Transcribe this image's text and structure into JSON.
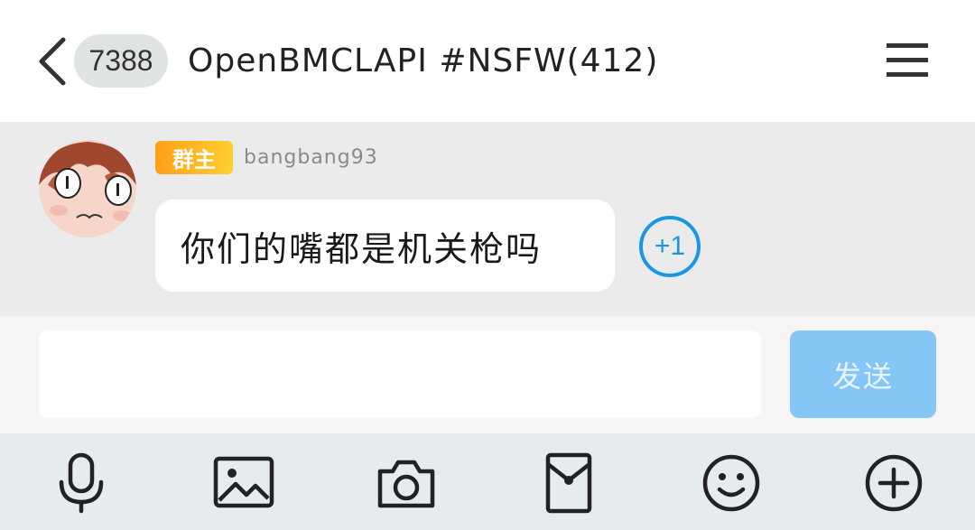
{
  "header": {
    "unread_count": "7388",
    "title": "OpenBMCLAPI #NSFW(412)"
  },
  "message": {
    "role_badge": "群主",
    "sender": "bangbang93",
    "text": "你们的嘴都是机关枪吗",
    "plus_one_label": "+1"
  },
  "composer": {
    "input_value": "",
    "send_label": "发送",
    "send_color": "#86c6f6"
  },
  "toolbar": {
    "tools": [
      "microphone-icon",
      "image-icon",
      "camera-icon",
      "red-packet-icon",
      "emoji-icon",
      "plus-icon"
    ]
  },
  "colors": {
    "accent": "#1a96e6",
    "badge_gradient_start": "#ff9f1a",
    "badge_gradient_end": "#ffcf2e"
  }
}
